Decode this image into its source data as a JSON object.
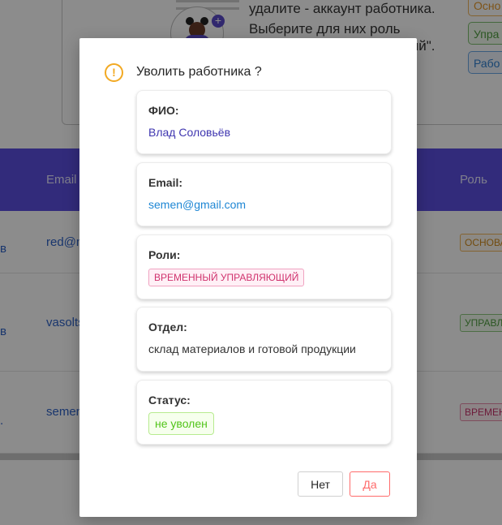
{
  "background": {
    "description_lines": [
      "удалите - аккаунт работника.",
      "Выберите для них роль",
      "ций\"."
    ],
    "role_buttons": [
      "Осно",
      "Упра",
      "Рабо"
    ],
    "table": {
      "headers": {
        "email": "Email",
        "role": "Роль"
      },
      "rows": [
        {
          "left": "в",
          "email": "red@m",
          "role": "ОСНОВА"
        },
        {
          "left": "в",
          "email": "vasolts",
          "role": "УПРАВЛ"
        },
        {
          "left": ".",
          "email": "semen",
          "role": "ВРЕМЕН"
        }
      ]
    }
  },
  "modal": {
    "title": "Уволить работника ?",
    "warning_icon_glyph": "!",
    "fio": {
      "label": "ФИО:",
      "value": "Влад Соловьёв"
    },
    "email": {
      "label": "Email:",
      "value": "semen@gmail.com"
    },
    "roles": {
      "label": "Роли:",
      "value": "ВРЕМЕННЫЙ УПРАВЛЯЮЩИЙ"
    },
    "department": {
      "label": "Отдел:",
      "value": "склад материалов и готовой продукции"
    },
    "status": {
      "label": "Статус:",
      "value": "не уволен"
    },
    "buttons": {
      "no": "Нет",
      "yes": "Да"
    }
  },
  "colors": {
    "primary": "#5b4fe0",
    "warning": "#f2a922",
    "danger": "#ff6b6b",
    "success": "#52c41a"
  }
}
